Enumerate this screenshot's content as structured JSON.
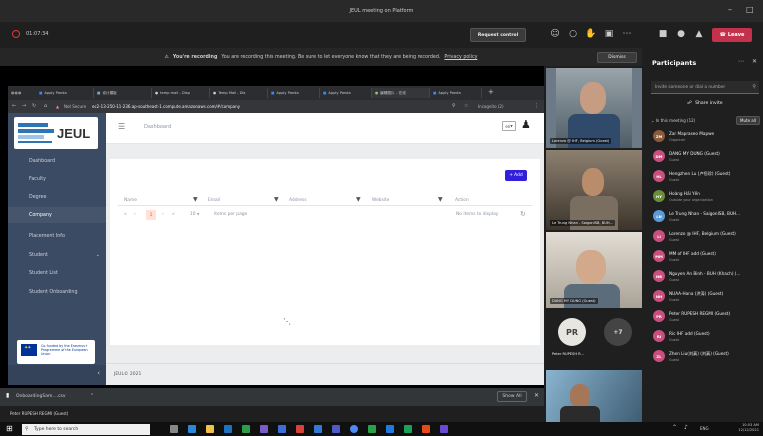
{
  "window": {
    "title": "JEUL meeting on Platform"
  },
  "meeting": {
    "timer": "01:07:34",
    "request_control": "Request control",
    "leave": "Leave",
    "banner_strong": "You're recording",
    "banner_text": "You are recording this meeting. Be sure to let everyone know that they are being recorded.",
    "privacy_link": "Privacy policy",
    "dismiss": "Dismiss"
  },
  "browser": {
    "tabs": [
      "Apply Panda",
      "设计模板",
      "temp mail - Disp",
      "Temp Mail - Dis",
      "Apply Panda",
      "Apply Panda",
      "编辑图片 – 在线",
      "Apply Panda"
    ],
    "url_prefix": "Not Secure",
    "url": "ec2-13-250-11-236.ap-southeast-1.compute.amazonaws.com/#/company",
    "incognito": "Incognito (2)"
  },
  "app": {
    "logo_text": "JEUL",
    "breadcrumb": "Dashboard",
    "lang": "en",
    "nav": [
      "Dashboard",
      "Faculty",
      "Degree",
      "Company",
      "Placement Info",
      "Student",
      "Student List",
      "Student Onboarding"
    ],
    "active_nav": 3,
    "eu_text": "Co-funded by the Erasmus+ Programme of the European Union",
    "add_label": "Add",
    "columns": [
      "Name",
      "Email",
      "Address",
      "Website",
      "Action"
    ],
    "page_number": "1",
    "per_page": "10",
    "per_page_label": "items per page",
    "no_items": "No items to display",
    "footer": "JEUL© 2021"
  },
  "download": {
    "file": "OnboardingSam....csv",
    "show_all": "Show All"
  },
  "presenter_name": "Peter RUPESH REGMI (Guest)",
  "videos": [
    {
      "label": "Lorenzo @ IHF, Belgium (Guest)"
    },
    {
      "label": "Le Trung Nhan - SaigonISB, BUH..."
    },
    {
      "label": "DANG MY DUNG (Guest)"
    },
    {
      "label": "Peter RUPESH R..."
    }
  ],
  "pr_initials": "PR",
  "more_count": "+7",
  "participants": {
    "title": "Participants",
    "invite_placeholder": "Invite someone or dial a number",
    "share_invite": "Share invite",
    "in_meeting": "In this meeting (12)",
    "mute_all": "Mute all",
    "list": [
      {
        "name": "Zar Mapraseo Mapwe",
        "role": "Organizer",
        "initials": "ZM",
        "color": "#8a5c3c"
      },
      {
        "name": "DANG MY DUNG (Guest)",
        "role": "Guest",
        "initials": "DM",
        "color": "#c84f7e"
      },
      {
        "name": "Hengzhen Lu (卢恒珍) (Guest)",
        "role": "Guest",
        "initials": "HL",
        "color": "#c84f7e"
      },
      {
        "name": "Hoàng Hải Yến",
        "role": "Outside your organization",
        "initials": "HY",
        "color": "#6b8e3a"
      },
      {
        "name": "Le Trung Nhan - SaigonISB, BUH...",
        "role": "Guest",
        "initials": "LN",
        "color": "#5b9bd5"
      },
      {
        "name": "Lorenzo @ IHF, Belgium (Guest)",
        "role": "Guest",
        "initials": "LI",
        "color": "#c84f7e"
      },
      {
        "name": "MM of IHF add (Guest)",
        "role": "Guest",
        "initials": "MM",
        "color": "#c84f7e"
      },
      {
        "name": "Nguyen An Binh - BUH (Khach) (...",
        "role": "Guest",
        "initials": "NB",
        "color": "#c84f7e"
      },
      {
        "name": "NUAA-Hana (洪涛) (Guest)",
        "role": "Guest",
        "initials": "NH",
        "color": "#c84f7e"
      },
      {
        "name": "Peter RUPESH REGMI (Guest)",
        "role": "Guest",
        "initials": "PR",
        "color": "#c84f7e"
      },
      {
        "name": "Ric IHF add (Guest)",
        "role": "Guest",
        "initials": "RI",
        "color": "#c84f7e"
      },
      {
        "name": "Zhen Liu(刘真) (刘真) (Guest)",
        "role": "Guest",
        "initials": "ZL",
        "color": "#c84f7e"
      }
    ]
  },
  "taskbar": {
    "search_placeholder": "Type here to search",
    "lang": "ENG",
    "time": "10:53 AM",
    "date": "12/12/2021"
  },
  "colors": {
    "sidebar": "#3c4b64",
    "primary": "#321fdb",
    "leave": "#c4314b",
    "teams_dark": "#1f1f1f"
  }
}
